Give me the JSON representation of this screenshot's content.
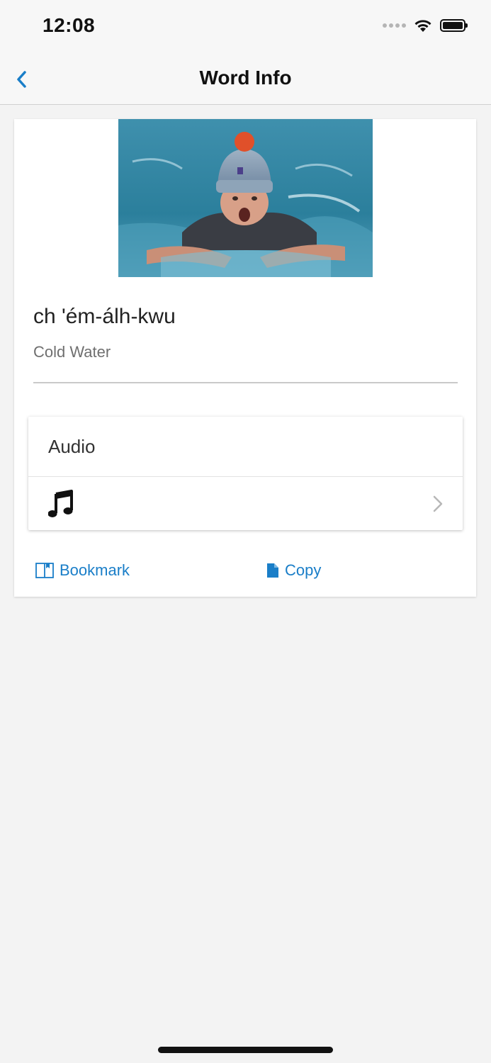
{
  "status_bar": {
    "time": "12:08"
  },
  "nav": {
    "title": "Word Info",
    "back_icon": "chevron-left-icon"
  },
  "word_card": {
    "image_alt": "Swimmer in cold water wearing a knit hat",
    "word": "ch 'ém-álh-kwu",
    "translation": "Cold Water"
  },
  "audio": {
    "header": "Audio",
    "icon": "music-note-icon",
    "chevron": "chevron-right-icon"
  },
  "actions": {
    "bookmark_label": "Bookmark",
    "copy_label": "Copy"
  },
  "colors": {
    "accent": "#1a7ec8",
    "background": "#f3f3f3"
  }
}
